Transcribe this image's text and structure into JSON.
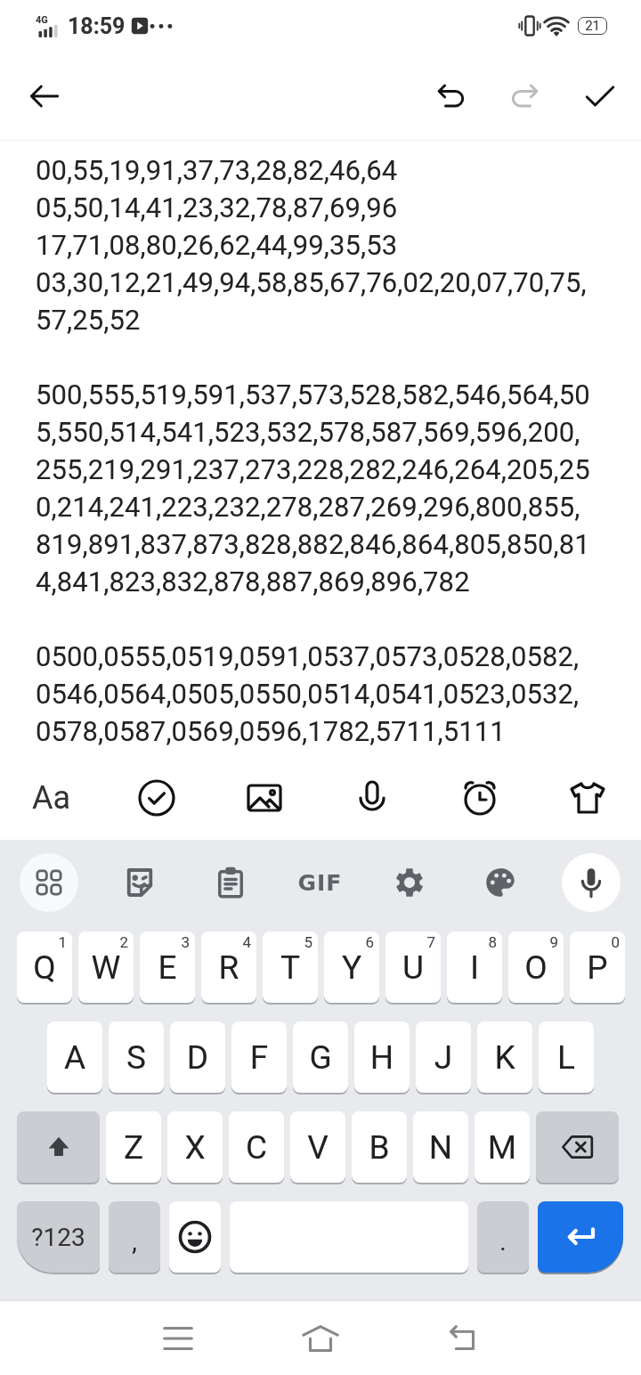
{
  "status_bar": {
    "network": "4G",
    "time": "18:59",
    "battery": "21"
  },
  "toolbar": {
    "actions": [
      {
        "kind": "undo",
        "disabled": false
      },
      {
        "kind": "redo",
        "disabled": true
      },
      {
        "kind": "done",
        "disabled": false
      }
    ]
  },
  "note": {
    "paragraphs": [
      {
        "lines": [
          "00,55,19,91,37,73,28,82,46,64",
          "05,50,14,41,23,32,78,87,69,96",
          "17,71,08,80,26,62,44,99,35,53",
          "03,30,12,21,49,94,58,85,67,76,02,20,07,70,75,",
          "57,25,52"
        ]
      },
      {
        "lines": [
          "500,555,519,591,537,573,528,582,546,564,50",
          "5,550,514,541,523,532,578,587,569,596,200,",
          "255,219,291,237,273,228,282,246,264,205,25",
          "0,214,241,223,232,278,287,269,296,800,855,",
          "819,891,837,873,828,882,846,864,805,850,81",
          "4,841,823,832,878,887,869,896,782"
        ]
      },
      {
        "lines": [
          "0500,0555,0519,0591,0537,0573,0528,0582,",
          "0546,0564,0505,0550,0514,0541,0523,0532,",
          "0578,0587,0569,0596,1782,5711,5111"
        ]
      }
    ]
  },
  "format_bar": {
    "text_style_label": "Aa",
    "tools": [
      {
        "kind": "checklist"
      },
      {
        "kind": "image"
      },
      {
        "kind": "voice"
      },
      {
        "kind": "reminder"
      },
      {
        "kind": "theme"
      }
    ]
  },
  "keyboard": {
    "suggestions": [
      {
        "kind": "apps"
      },
      {
        "kind": "sticker"
      },
      {
        "kind": "clipboard"
      },
      {
        "kind": "gif",
        "label": "GIF"
      },
      {
        "kind": "settings"
      },
      {
        "kind": "palette"
      },
      {
        "kind": "mic"
      }
    ],
    "rows": [
      [
        {
          "label": "Q",
          "hint": "1"
        },
        {
          "label": "W",
          "hint": "2"
        },
        {
          "label": "E",
          "hint": "3"
        },
        {
          "label": "R",
          "hint": "4"
        },
        {
          "label": "T",
          "hint": "5"
        },
        {
          "label": "Y",
          "hint": "6"
        },
        {
          "label": "U",
          "hint": "7"
        },
        {
          "label": "I",
          "hint": "8"
        },
        {
          "label": "O",
          "hint": "9"
        },
        {
          "label": "P",
          "hint": "0"
        }
      ],
      [
        {
          "label": "A"
        },
        {
          "label": "S"
        },
        {
          "label": "D"
        },
        {
          "label": "F"
        },
        {
          "label": "G"
        },
        {
          "label": "H"
        },
        {
          "label": "J"
        },
        {
          "label": "K"
        },
        {
          "label": "L"
        }
      ],
      [
        {
          "kind": "shift"
        },
        {
          "label": "Z"
        },
        {
          "label": "X"
        },
        {
          "label": "C"
        },
        {
          "label": "V"
        },
        {
          "label": "B"
        },
        {
          "label": "N"
        },
        {
          "label": "M"
        },
        {
          "kind": "backspace"
        }
      ]
    ],
    "bottom_row": [
      {
        "kind": "symbols",
        "label": "?123"
      },
      {
        "kind": "comma",
        "label": ","
      },
      {
        "kind": "emoji"
      },
      {
        "kind": "space"
      },
      {
        "kind": "period",
        "label": "."
      },
      {
        "kind": "enter"
      }
    ]
  },
  "nav_bar": {
    "buttons": [
      {
        "kind": "recents"
      },
      {
        "kind": "home"
      },
      {
        "kind": "back"
      }
    ]
  }
}
